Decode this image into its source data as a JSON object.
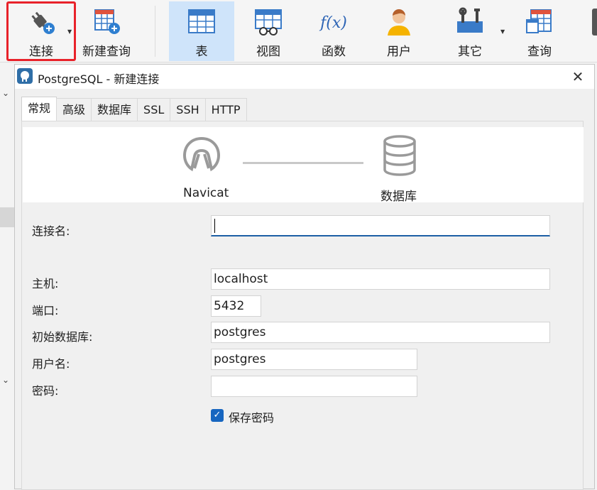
{
  "toolbar": {
    "connect": "连接",
    "new_query": "新建查询",
    "table": "表",
    "view": "视图",
    "function": "函数",
    "user": "用户",
    "other": "其它",
    "query": "查询",
    "function_glyph": "f(x)"
  },
  "dialog": {
    "title": "PostgreSQL - 新建连接",
    "tabs": [
      "常规",
      "高级",
      "数据库",
      "SSL",
      "SSH",
      "HTTP"
    ],
    "banner": {
      "left_label": "Navicat",
      "right_label": "数据库"
    },
    "form": {
      "connection_name_label": "连接名:",
      "connection_name_value": "",
      "host_label": "主机:",
      "host_value": "localhost",
      "port_label": "端口:",
      "port_value": "5432",
      "initial_db_label": "初始数据库:",
      "initial_db_value": "postgres",
      "username_label": "用户名:",
      "username_value": "postgres",
      "password_label": "密码:",
      "password_value": "",
      "save_password_label": "保存密码",
      "save_password_checked": true
    }
  },
  "colors": {
    "accent": "#1766c0",
    "highlight_border": "#e8222a",
    "active_tool_bg": "#cfe4fa"
  }
}
